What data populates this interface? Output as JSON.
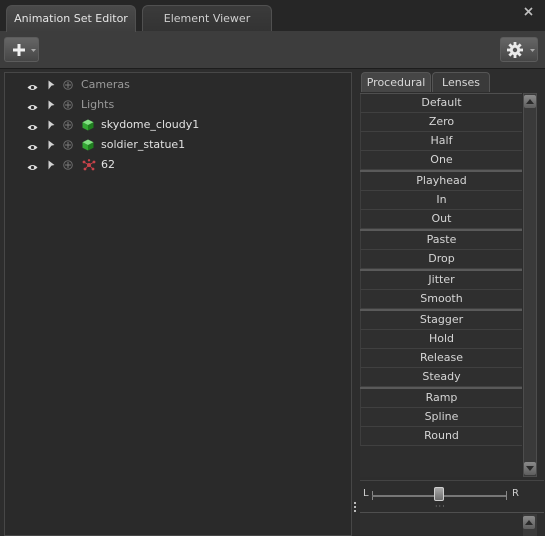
{
  "tabs": [
    {
      "label": "Animation Set Editor",
      "active": true
    },
    {
      "label": "Element Viewer",
      "active": false
    }
  ],
  "close_icon": "close-icon",
  "toolbar": {
    "add_button_icon": "plus-icon",
    "settings_button_icon": "gear-icon"
  },
  "tree": {
    "rows": [
      {
        "label": "Cameras",
        "icon": "none",
        "style": "dim"
      },
      {
        "label": "Lights",
        "icon": "none",
        "style": "dim"
      },
      {
        "label": "skydome_cloudy1",
        "icon": "green-cube-icon",
        "style": "bright"
      },
      {
        "label": "soldier_statue1",
        "icon": "green-cube-icon",
        "style": "bright"
      },
      {
        "label": "62",
        "icon": "red-particles-icon",
        "style": "bright"
      }
    ]
  },
  "right_panel": {
    "tabs": [
      {
        "label": "Procedural",
        "active": true
      },
      {
        "label": "Lenses",
        "active": false
      }
    ],
    "groups": [
      [
        "Default",
        "Zero",
        "Half",
        "One"
      ],
      [
        "Playhead",
        "In",
        "Out"
      ],
      [
        "Paste",
        "Drop"
      ],
      [
        "Jitter",
        "Smooth"
      ],
      [
        "Stagger",
        "Hold",
        "Release",
        "Steady"
      ],
      [
        "Ramp",
        "Spline",
        "Round"
      ]
    ],
    "slider": {
      "left_label": "L",
      "right_label": "R",
      "value": 0.5
    }
  },
  "colors": {
    "background": "#2d2d2d",
    "panel": "#2a2a2a",
    "cube_green": "#3fbf3f",
    "particles_red": "#c03a3a"
  }
}
